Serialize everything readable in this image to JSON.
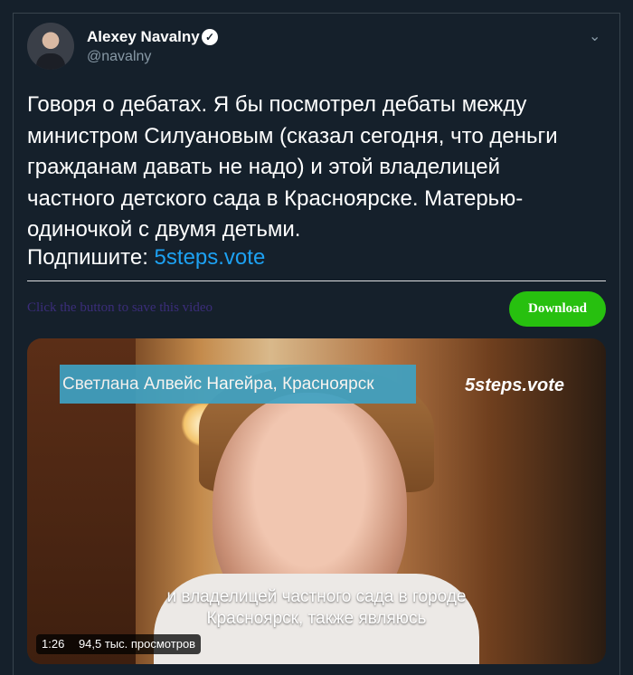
{
  "tweet": {
    "author_name": "Alexey Navalny",
    "handle": "@navalny",
    "verified_icon": "verified-badge-icon",
    "menu_icon": "chevron-down-icon",
    "text": "Говоря о дебатах. Я бы посмотрел дебаты между\nминистром Силуановым (сказал сегодня, что деньги\nгражданам давать не надо) и этой владелицей\nчастного детского сада в Красноярске. Матерью-\nодиночкой с двумя детьми.",
    "sign_label": "Подпишите: ",
    "link_text": "5steps.vote"
  },
  "extension": {
    "hint": "Click the button to save this video",
    "download_label": "Download",
    "download_color": "#27c00f"
  },
  "video": {
    "nameplate": "Светлана Алвейс Нагейра, Красноярск",
    "brand": "5steps.vote",
    "subtitle": "и владелицей частного сада в городе\nКрасноярск, также являюсь",
    "duration": "1:26",
    "views": "94,5 тыс. просмотров"
  },
  "colors": {
    "background": "#15202b",
    "link": "#1da1f2",
    "secondary_text": "#8899a6"
  }
}
